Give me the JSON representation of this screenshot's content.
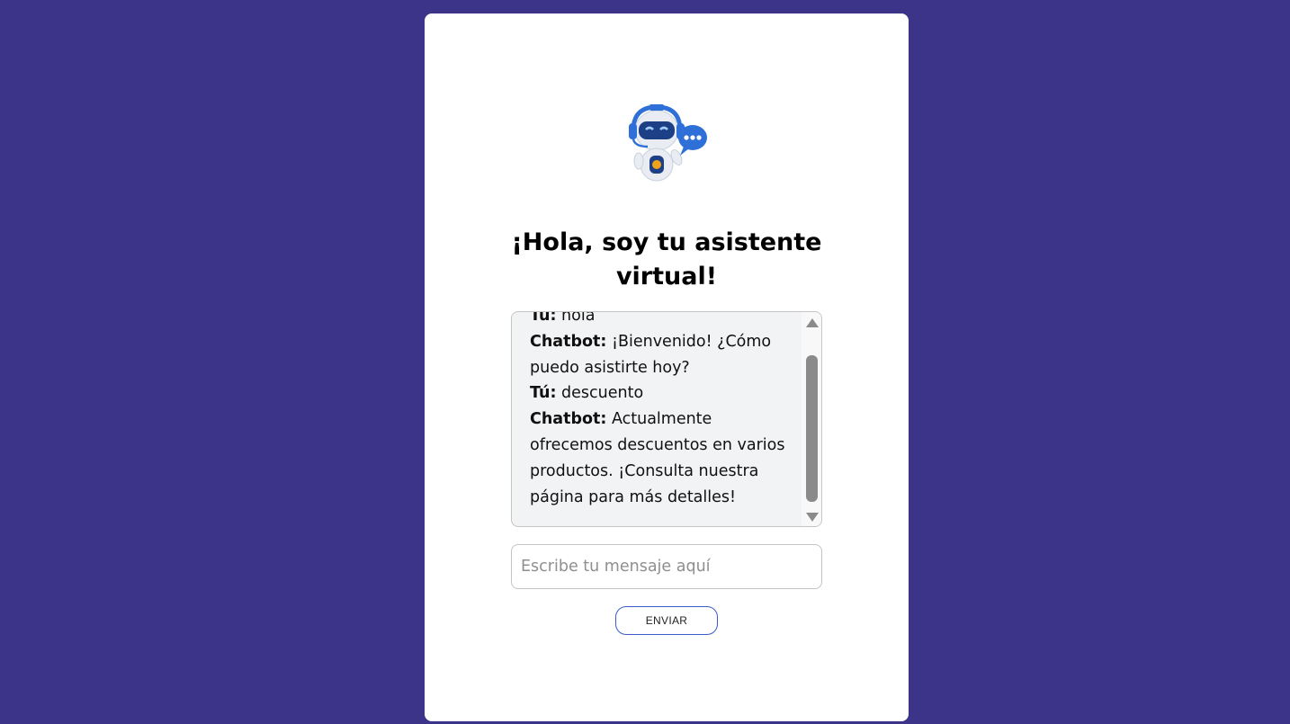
{
  "header": {
    "title_line1": "¡Hola, soy tu asistente",
    "title_line2": "virtual!"
  },
  "chat": {
    "messages": [
      {
        "sender": "Tú:",
        "text": " hola"
      },
      {
        "sender": "Chatbot:",
        "text": " ¡Bienvenido! ¿Cómo puedo asistirte hoy?"
      },
      {
        "sender": "Tú:",
        "text": " descuento"
      },
      {
        "sender": "Chatbot:",
        "text": " Actualmente ofrecemos descuentos en varios productos. ¡Consulta nuestra página para más detalles!"
      }
    ]
  },
  "input": {
    "placeholder": "Escribe tu mensaje aquí",
    "value": ""
  },
  "send_button": {
    "label": "ENVIAR"
  },
  "colors": {
    "background": "#3c3488",
    "card": "#ffffff",
    "chat_bg": "#f2f3f5",
    "button_border": "#3a5bc9",
    "robot_blue": "#2f6fd8"
  },
  "icons": {
    "avatar": "robot-assistant-icon",
    "chat_bubble": "chat-bubble-icon"
  }
}
